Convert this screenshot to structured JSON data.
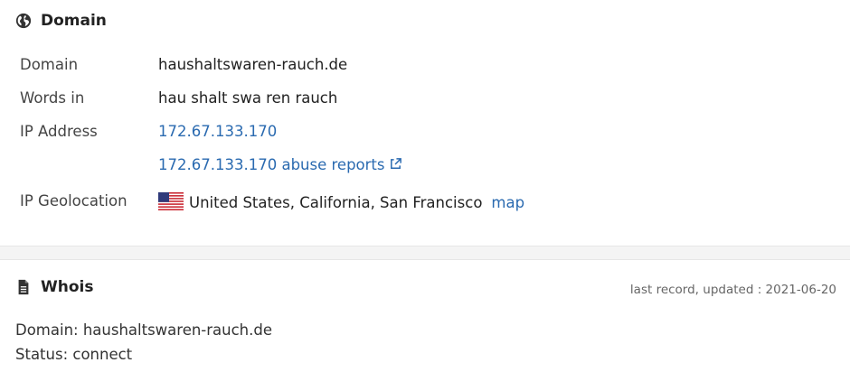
{
  "domain_section": {
    "title": "Domain",
    "icon": "globe-icon",
    "rows": {
      "domain": {
        "label": "Domain",
        "value": "haushaltswaren-rauch.de"
      },
      "words": {
        "label": "Words in",
        "value": "hau shalt swa ren rauch"
      },
      "ip": {
        "label": "IP Address",
        "value": "172.67.133.170"
      },
      "abuse": {
        "value": "172.67.133.170 abuse reports"
      },
      "geo": {
        "label": "IP Geolocation",
        "value": "United States, California, San Francisco",
        "map_label": "map"
      }
    }
  },
  "whois_section": {
    "title": "Whois",
    "icon": "document-icon",
    "updated": "last record, updated : 2021-06-20",
    "lines": [
      "Domain: haushaltswaren-rauch.de",
      "Status: connect"
    ]
  },
  "colors": {
    "link": "#2a6ab0",
    "text": "#222222",
    "label": "#444444",
    "divider": "#f4f4f4"
  }
}
